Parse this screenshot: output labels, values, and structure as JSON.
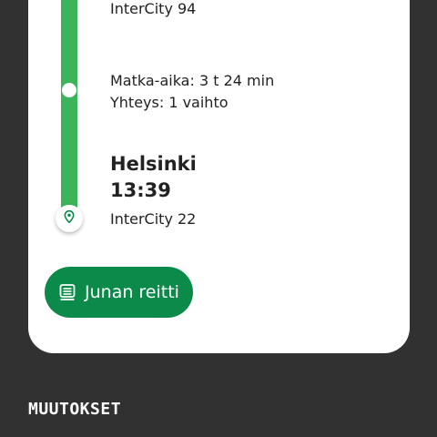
{
  "journey": {
    "first_train": "InterCity 94",
    "travel_time": "Matka-aika: 3 t 24 min",
    "connection": "Yhteys: 1 vaihto",
    "destination": {
      "station": "Helsinki",
      "time": "13:39",
      "train": "InterCity 22"
    }
  },
  "actions": {
    "route_button_label": "Junan reitti"
  },
  "sections": {
    "changes_title": "MUUTOKSET"
  },
  "icons": {
    "destination_marker": "map-pin-icon",
    "route_button": "train-route-icon"
  },
  "colors": {
    "route_line": "#3cb45a",
    "primary_button": "#0b8a4a",
    "background": "#313131"
  }
}
